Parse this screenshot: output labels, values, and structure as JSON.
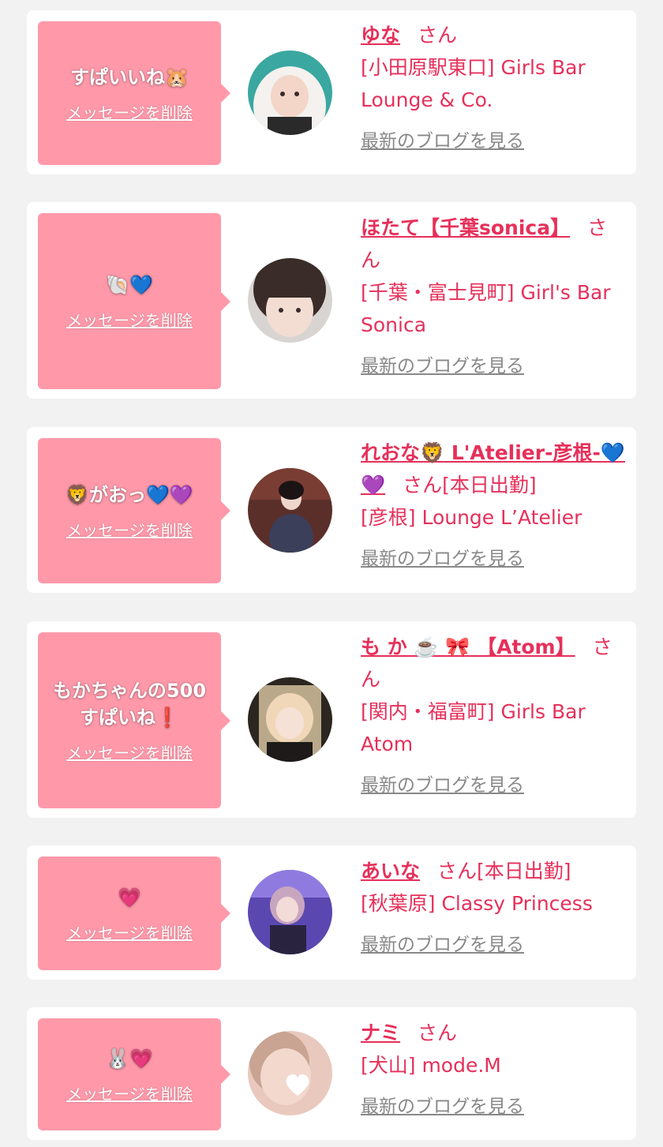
{
  "colors": {
    "accent": "#e6305a",
    "bubble": "#ff99aa",
    "card": "#ffffff",
    "background": "#f2f2f2",
    "link_gray": "#888888"
  },
  "delete_label": "メッセージを削除",
  "blog_label": "最新のブログを見る",
  "cards": [
    {
      "message": "すぱいいね🐹",
      "name": "ゆな",
      "suffix": "さん",
      "shop": "[小田原駅東口] Girls Bar Lounge & Co."
    },
    {
      "message": "🐚💙",
      "name": "ほたて【千葉sonica】",
      "suffix": "さん",
      "shop": "[千葉・富士見町] Girl's Bar Sonica"
    },
    {
      "message": "🦁がおっ💙💜",
      "name": "れおな🦁 L'Atelier-彦根-💙💜",
      "suffix": "さん[本日出勤]",
      "shop": "[彦根] Lounge L’Atelier"
    },
    {
      "message": "もかちゃんの500すぱいね❗️",
      "name": "も か ☕️ 🎀 【Atom】",
      "suffix": "さん",
      "shop": "[関内・福富町] Girls Bar Atom"
    },
    {
      "message": "💗",
      "name": "あいな",
      "suffix": "さん[本日出勤]",
      "shop": "[秋葉原] Classy Princess"
    },
    {
      "message": "🐰💗",
      "name": "ナミ",
      "suffix": "さん",
      "shop": "[犬山] mode.M"
    }
  ]
}
